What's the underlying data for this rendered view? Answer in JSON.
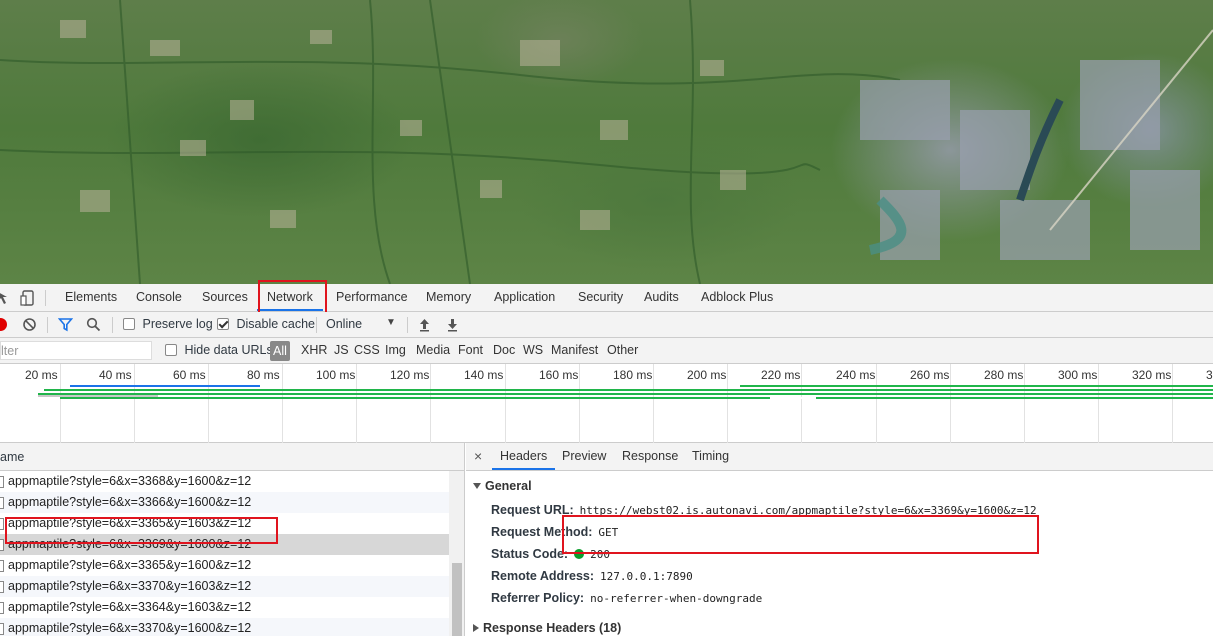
{
  "devtools": {
    "tabs": [
      "Elements",
      "Console",
      "Sources",
      "Network",
      "Performance",
      "Memory",
      "Application",
      "Security",
      "Audits",
      "Adblock Plus"
    ],
    "active_tab": "Network"
  },
  "toolbar": {
    "preserve_log": "Preserve log",
    "disable_cache": "Disable cache",
    "disable_cache_checked": true,
    "throttling": "Online"
  },
  "filter": {
    "placeholder": "lter",
    "hide_data_urls": "Hide data URLs",
    "types": [
      "All",
      "XHR",
      "JS",
      "CSS",
      "Img",
      "Media",
      "Font",
      "Doc",
      "WS",
      "Manifest",
      "Other"
    ],
    "active_type": "All"
  },
  "timeline": {
    "ticks": [
      "20 ms",
      "40 ms",
      "60 ms",
      "80 ms",
      "100 ms",
      "120 ms",
      "140 ms",
      "160 ms",
      "180 ms",
      "200 ms",
      "220 ms",
      "240 ms",
      "260 ms",
      "280 ms",
      "300 ms",
      "320 ms",
      "3"
    ]
  },
  "requests": {
    "column_header": "ame",
    "rows": [
      "appmaptile?style=6&x=3368&y=1600&z=12",
      "appmaptile?style=6&x=3366&y=1600&z=12",
      "appmaptile?style=6&x=3365&y=1603&z=12",
      "appmaptile?style=6&x=3369&y=1600&z=12",
      "appmaptile?style=6&x=3365&y=1600&z=12",
      "appmaptile?style=6&x=3370&y=1603&z=12",
      "appmaptile?style=6&x=3364&y=1603&z=12",
      "appmaptile?style=6&x=3370&y=1600&z=12"
    ],
    "selected_index": 3
  },
  "details": {
    "close": "×",
    "tabs": [
      "Headers",
      "Preview",
      "Response",
      "Timing"
    ],
    "active_tab": "Headers",
    "general_title": "General",
    "request_url_label": "Request URL:",
    "request_url": "https://webst02.is.autonavi.com/appmaptile?style=6&x=3369&y=1600&z=12",
    "request_method_label": "Request Method:",
    "request_method": "GET",
    "status_code_label": "Status Code:",
    "status_code": "200",
    "status_color": "#0a9e2c",
    "remote_address_label": "Remote Address:",
    "remote_address": "127.0.0.1:7890",
    "referrer_policy_label": "Referrer Policy:",
    "referrer_policy": "no-referrer-when-downgrade",
    "response_headers_title": "Response Headers (18)"
  },
  "colors": {
    "highlight_box": "#e0141e",
    "accent": "#1a73e8",
    "record": "#e00000",
    "timeline_bar": "#20b54a"
  }
}
